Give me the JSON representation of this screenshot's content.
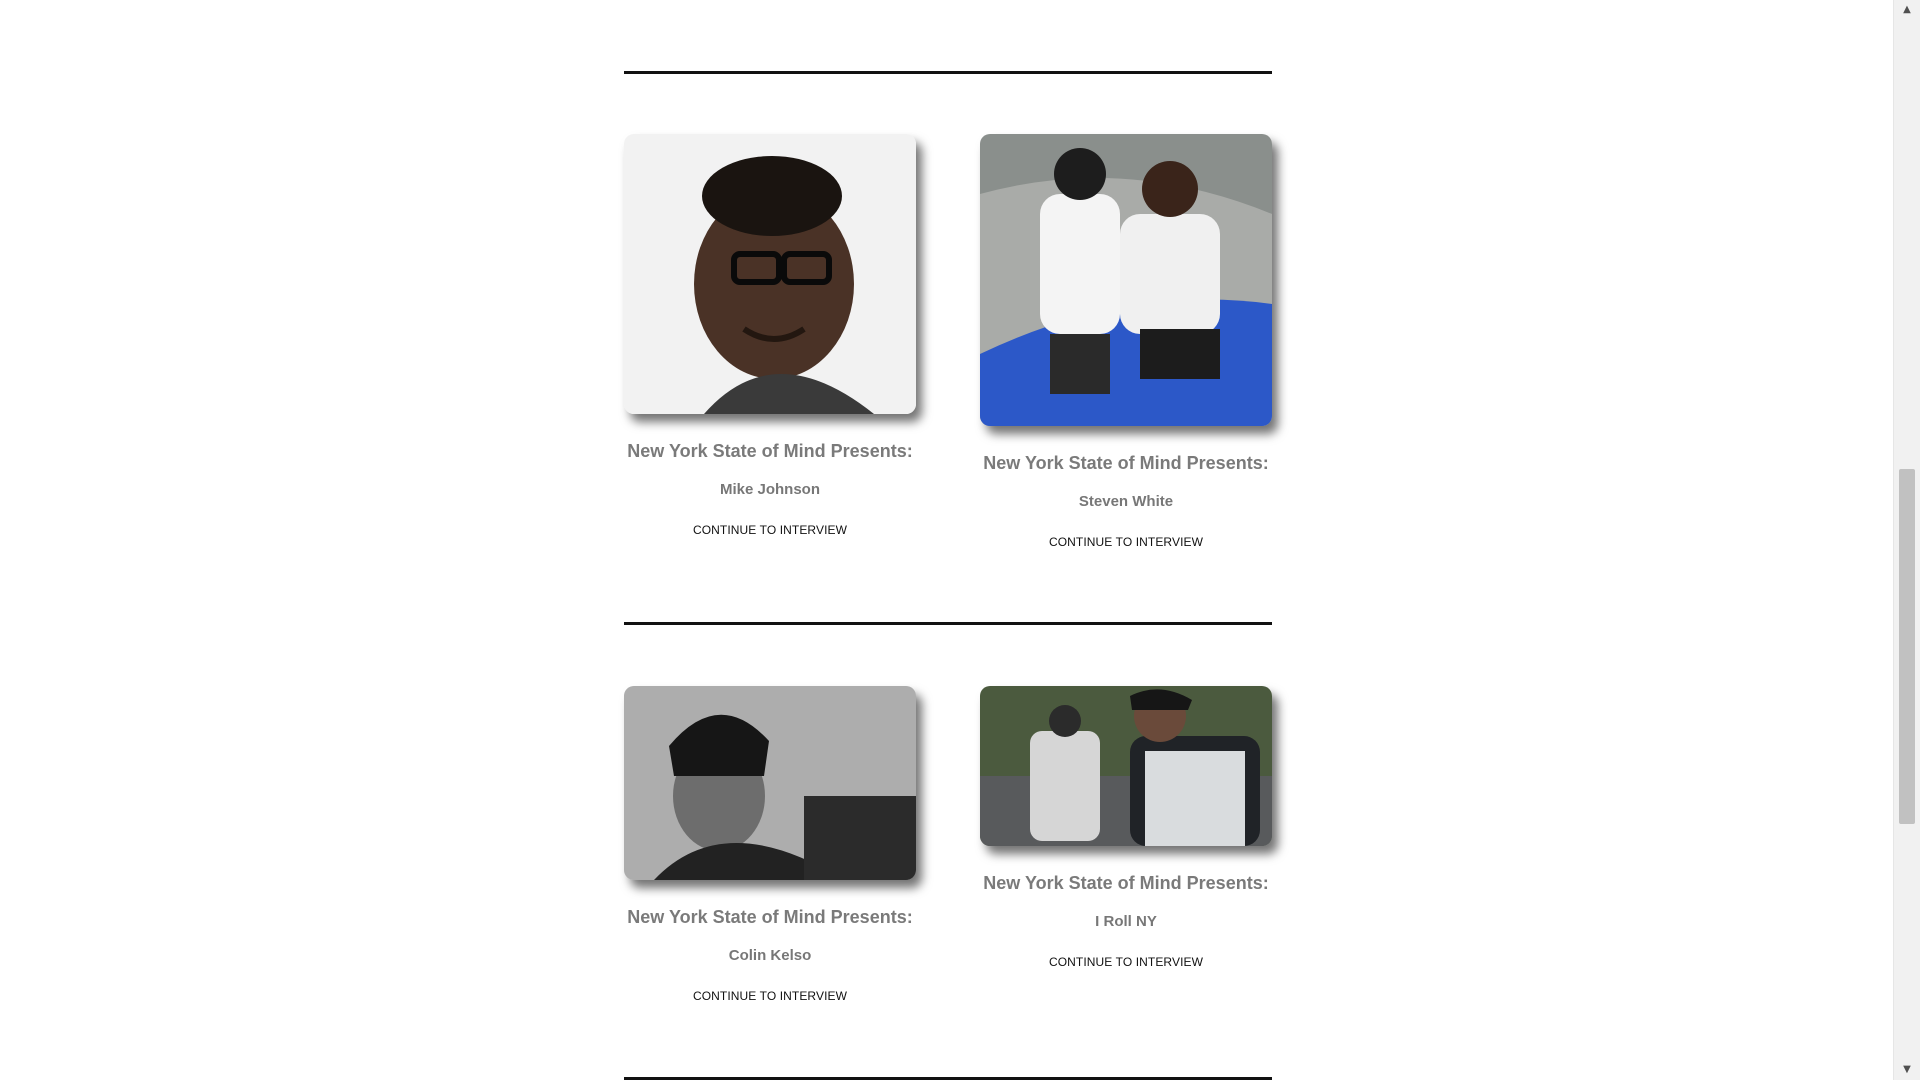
{
  "cards": [
    {
      "presents": "New York State of Mind Presents:",
      "name": "Mike Johnson",
      "cta": "CONTINUE TO INTERVIEW"
    },
    {
      "presents": "New York State of Mind Presents:",
      "name": "Steven White",
      "cta": "CONTINUE TO INTERVIEW"
    },
    {
      "presents": "New York State of Mind Presents:",
      "name": "Colin Kelso",
      "cta": "CONTINUE TO INTERVIEW"
    },
    {
      "presents": "New York State of Mind Presents:",
      "name": "I Roll NY",
      "cta": "CONTINUE TO INTERVIEW"
    }
  ],
  "scrollbar": {
    "up_icon": "arrow-up-icon",
    "down_icon": "arrow-down-icon"
  },
  "colors": {
    "heading": "#7a7a7a",
    "divider": "#111111",
    "link": "#111111"
  }
}
